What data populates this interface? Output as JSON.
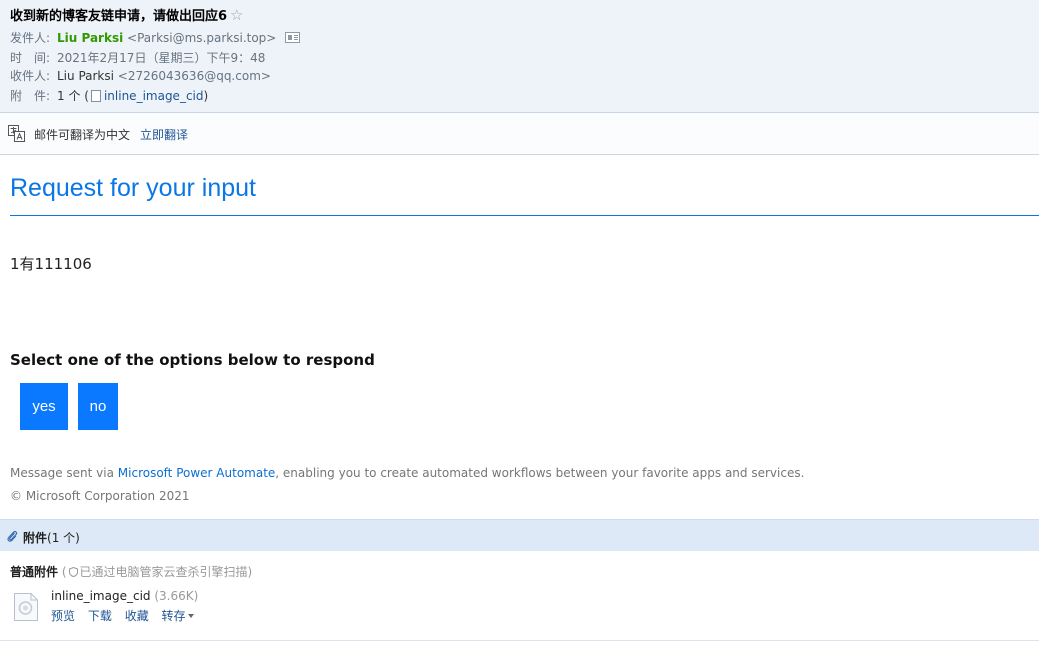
{
  "email": {
    "subject": "收到新的博客友链申请，请做出回应6",
    "star_glyph": "☆",
    "from_label": "发件人:",
    "from_name": "Liu Parksi",
    "from_address": "<Parksi@ms.parksi.top>",
    "time_label": "时　间:",
    "time_value": "2021年2月17日（星期三）下午9：48",
    "to_label": "收件人:",
    "to_name": "Liu Parksi",
    "to_address": "<2726043636@qq.com>",
    "attach_label": "附　件:",
    "attach_count": "1 个",
    "attach_open": "(",
    "attach_link": "inline_image_cid",
    "attach_close": ")"
  },
  "translate": {
    "text": "邮件可翻译为中文",
    "link": "立即翻译"
  },
  "content": {
    "title": "Request for your input",
    "body": "1有111106",
    "prompt": "Select one of the options below to respond",
    "options": [
      "yes",
      "no"
    ],
    "footer_prefix": "Message sent via ",
    "footer_link": "Microsoft Power Automate",
    "footer_suffix": ", enabling you to create automated workflows between your favorite apps and services.",
    "copyright": "© Microsoft Corporation 2021"
  },
  "attachments": {
    "header_label": "附件",
    "header_count": "(1 个)",
    "normal_label": "普通附件",
    "scan_open": " (",
    "scan_note": "已通过电脑管家云查杀引擎扫描",
    "scan_close": ")",
    "files": [
      {
        "name": "inline_image_cid",
        "size": "(3.66K)",
        "actions": [
          "预览",
          "下载",
          "收藏",
          "转存"
        ]
      }
    ]
  },
  "colors": {
    "accent": "#0b77e6",
    "button": "#0a79ff",
    "sender": "#339900",
    "link": "#1e5494",
    "header_bg": "#eef3f9"
  }
}
